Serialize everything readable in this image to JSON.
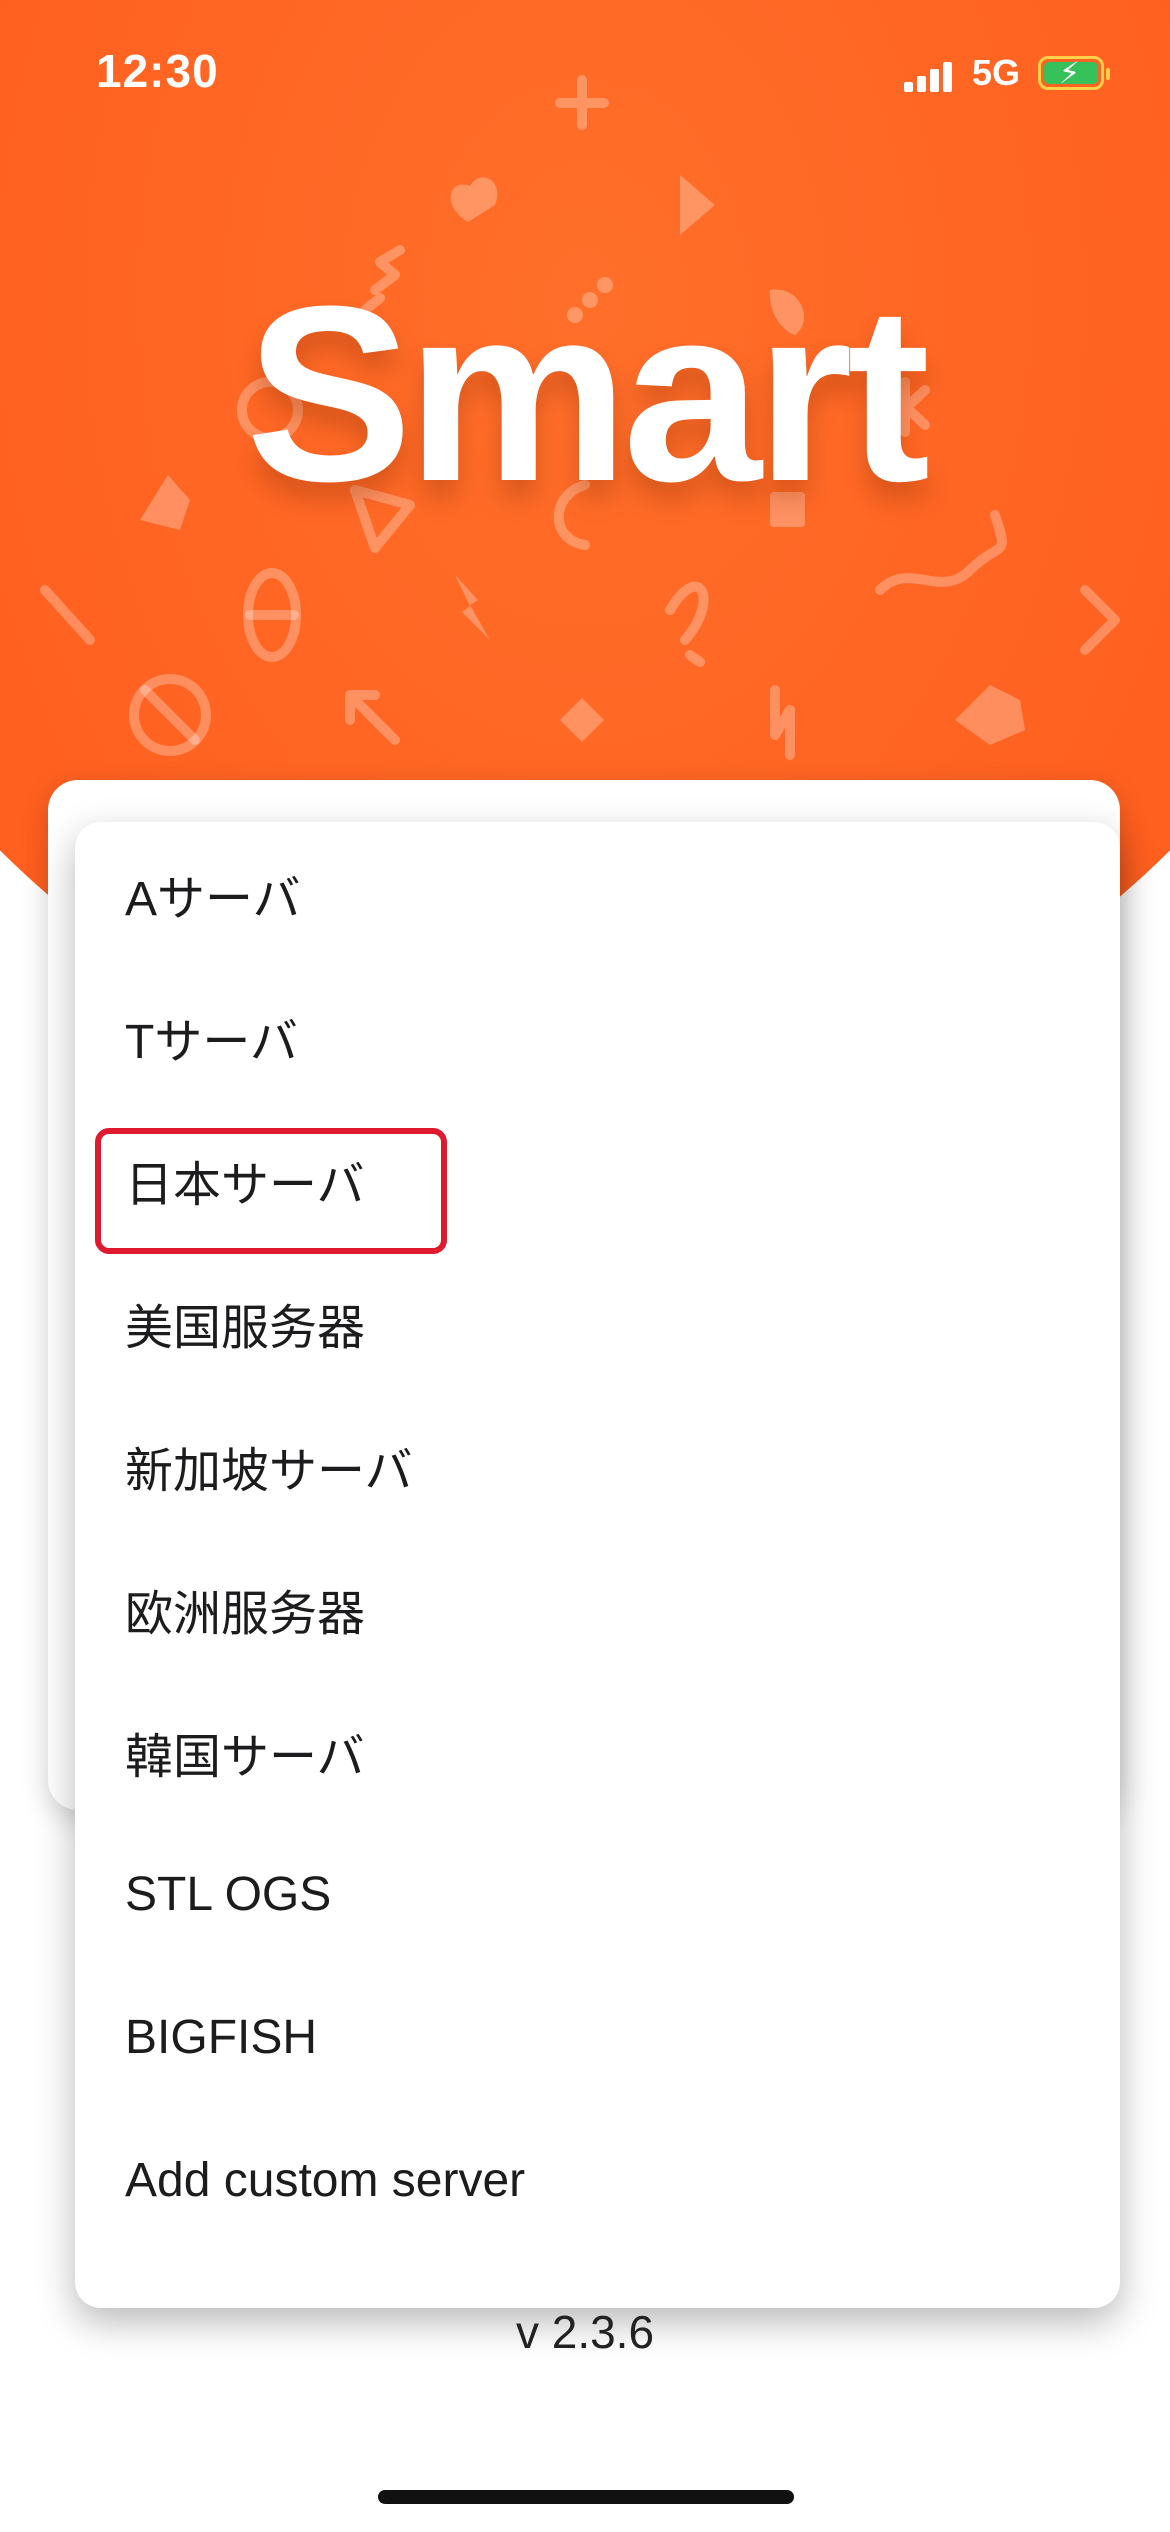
{
  "status_bar": {
    "time": "12:30",
    "network": "5G",
    "signal_bars": 4,
    "battery_state": "charging"
  },
  "app": {
    "logo_text": "Smart",
    "accent_color": "#ff5f1f"
  },
  "server_menu": {
    "items": [
      {
        "label": "Aサーバ"
      },
      {
        "label": "Tサーバ"
      },
      {
        "label": "日本サーバ",
        "selected": true
      },
      {
        "label": "美国服务器"
      },
      {
        "label": "新加坡サーバ"
      },
      {
        "label": "欧洲服务器"
      },
      {
        "label": "韓国サーバ"
      },
      {
        "label": "STL OGS"
      },
      {
        "label": "BIGFISH"
      },
      {
        "label": "Add custom server"
      }
    ],
    "highlight_color": "#e01a2e"
  },
  "footer": {
    "version": "v 2.3.6"
  }
}
